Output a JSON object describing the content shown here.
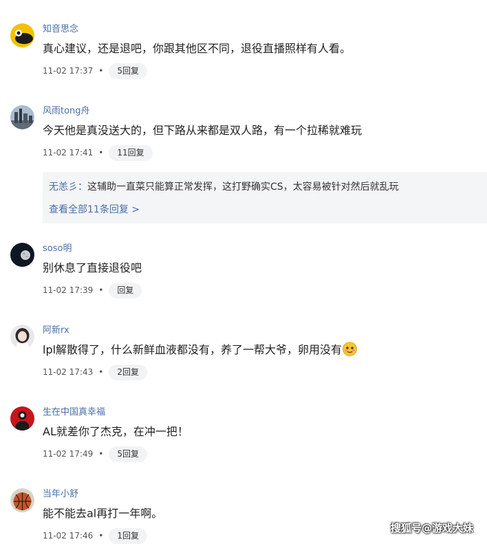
{
  "comments": [
    {
      "username": "知音思念",
      "text": "真心建议，还是退吧，你跟其他区不同，退役直播照样有人看。",
      "time": "11-02 17:37",
      "reply": "5回复",
      "avatar": "yellow-avatar"
    },
    {
      "username": "风雨tong舟",
      "text": "今天他是真没送大的，但下路从来都是双人路，有一个拉稀就难玩",
      "time": "11-02 17:41",
      "reply": "11回复",
      "avatar": "city-avatar"
    },
    {
      "username": "soso明",
      "text": "别休息了直接退役吧",
      "time": "11-02 17:39",
      "reply": "回复",
      "avatar": "moon-avatar"
    },
    {
      "username": "阿新rx",
      "text": "lpl解散得了，什么新鲜血液都没有，养了一帮大爷，卵用没有",
      "time": "11-02 17:43",
      "reply": "2回复",
      "avatar": "girl-avatar",
      "emoji": "smile-emoji"
    },
    {
      "username": "生在中国真幸福",
      "text": "AL就差你了杰克，在冲一把！",
      "time": "11-02 17:49",
      "reply": "5回复",
      "avatar": "red-figure-avatar"
    },
    {
      "username": "当年小舒",
      "text": "能不能去al再打一年啊。",
      "time": "11-02 17:46",
      "reply": "1回复",
      "avatar": "basketball-avatar"
    }
  ],
  "reply_preview": {
    "author": "无恙彡：",
    "text": "这辅助一直菜只能算正常发挥，这打野确实CS，太容易被针对然后就乱玩",
    "view_all": "查看全部11条回复 >"
  },
  "separator": "•",
  "watermark": "搜狐号@游戏大妹"
}
